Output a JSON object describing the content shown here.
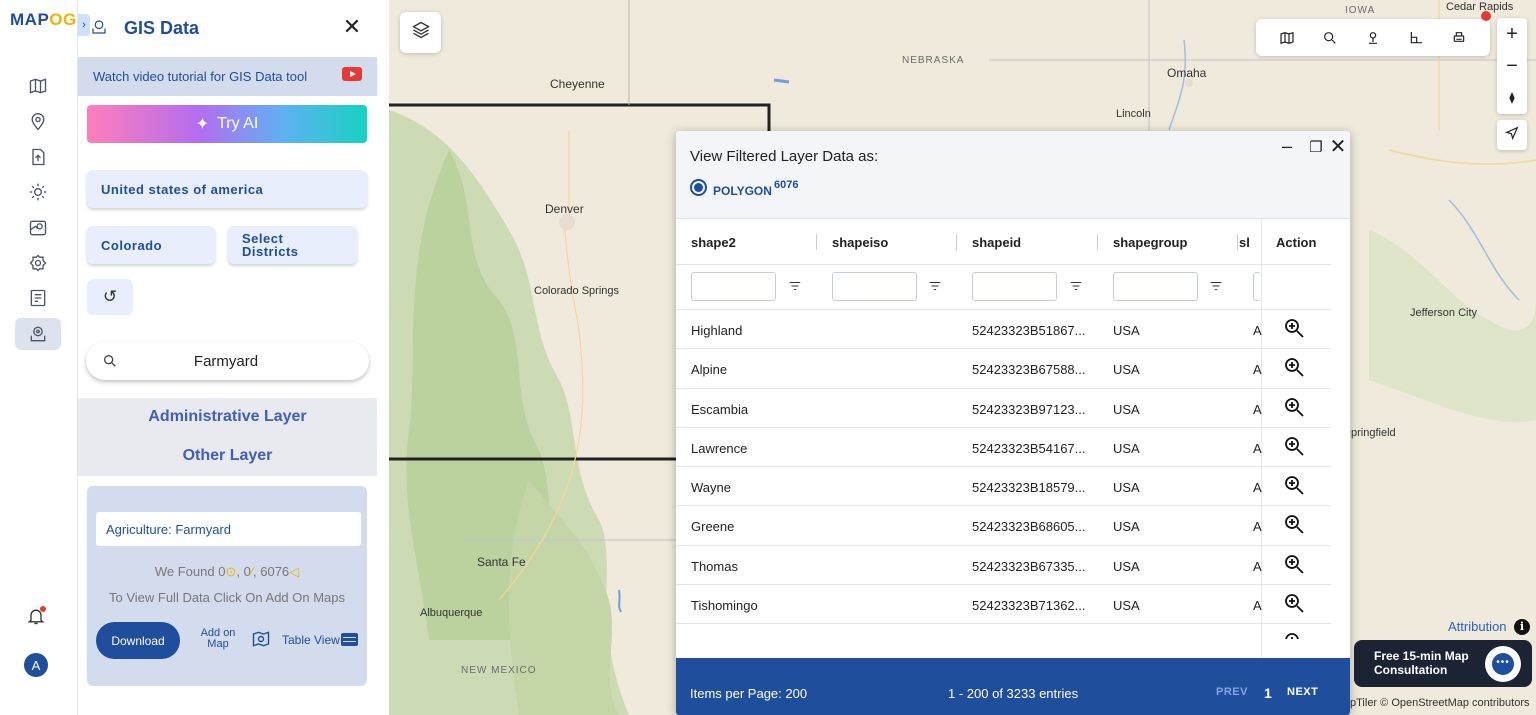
{
  "brand": {
    "logo_part1": "MAP",
    "logo_part2": "OG"
  },
  "rail": {
    "items": [
      "map-icon",
      "location-pin-icon",
      "upload-icon",
      "gear-icon",
      "map-pin-icon",
      "settings-icon",
      "report-icon",
      "gis-data-icon"
    ],
    "active": "gis-data-icon",
    "avatar_letter": "A"
  },
  "panel": {
    "title": "GIS Data",
    "tutorial_text": "Watch video tutorial for GIS Data tool",
    "try_ai_label": "Try AI",
    "country": "United states of america",
    "state": "Colorado",
    "district_label": "Select Districts",
    "search_value": "Farmyard",
    "admin_layer_label": "Administrative Layer",
    "other_layer_label": "Other Layer",
    "result": {
      "name": "Agriculture: Farmyard",
      "found_prefix": "We Found",
      "found_points": "0",
      "found_lines": "0",
      "found_polygons": "6076",
      "hint": "To View Full Data Click On Add On Maps",
      "download_label": "Download",
      "add_on_map_label": "Add on Map",
      "table_view_label": "Table View"
    }
  },
  "map": {
    "labels": {
      "nebraska": "NEBRASKA",
      "iowa": "IOWA",
      "new_mexico": "NEW MEXICO",
      "cheyenne": "Cheyenne",
      "omaha": "Omaha",
      "lincoln": "Lincoln",
      "denver": "Denver",
      "colorado_springs": "Colorado Springs",
      "santa_fe": "Santa Fe",
      "albuquerque": "Albuquerque",
      "cedar_rapids": "Cedar Rapids",
      "jefferson_city": "Jefferson City",
      "springfield": "pringfield"
    },
    "attribution_label": "Attribution",
    "consult_line1": "Free 15-min Map",
    "consult_line2": "Consultation",
    "copyright": "pTiler © OpenStreetMap contributors"
  },
  "dialog": {
    "title": "View Filtered Layer Data as:",
    "option_label": "POLYGON",
    "option_count": "6076",
    "columns": [
      "shape2",
      "shapeiso",
      "shapeid",
      "shapegroup",
      "sl",
      "Action"
    ],
    "rows": [
      {
        "shape2": "Highland",
        "shapeiso": "",
        "shapeid": "52423323B51867...",
        "shapegroup": "USA",
        "sl": "A"
      },
      {
        "shape2": "Alpine",
        "shapeiso": "",
        "shapeid": "52423323B67588...",
        "shapegroup": "USA",
        "sl": "A"
      },
      {
        "shape2": "Escambia",
        "shapeiso": "",
        "shapeid": "52423323B97123...",
        "shapegroup": "USA",
        "sl": "A"
      },
      {
        "shape2": "Lawrence",
        "shapeiso": "",
        "shapeid": "52423323B54167...",
        "shapegroup": "USA",
        "sl": "A"
      },
      {
        "shape2": "Wayne",
        "shapeiso": "",
        "shapeid": "52423323B18579...",
        "shapegroup": "USA",
        "sl": "A"
      },
      {
        "shape2": "Greene",
        "shapeiso": "",
        "shapeid": "52423323B68605...",
        "shapegroup": "USA",
        "sl": "A"
      },
      {
        "shape2": "Thomas",
        "shapeiso": "",
        "shapeid": "52423323B67335...",
        "shapegroup": "USA",
        "sl": "A"
      },
      {
        "shape2": "Tishomingo",
        "shapeiso": "",
        "shapeid": "52423323B71362...",
        "shapegroup": "USA",
        "sl": "A"
      }
    ],
    "footer": {
      "items_per_page": "Items per Page: 200",
      "range": "1 - 200 of 3233 entries",
      "prev": "PREV",
      "page": "1",
      "next": "NEXT"
    }
  },
  "colors": {
    "brand_blue": "#1f4e9c",
    "accent_yellow": "#f0b400",
    "map_bg": "#efeadb"
  }
}
